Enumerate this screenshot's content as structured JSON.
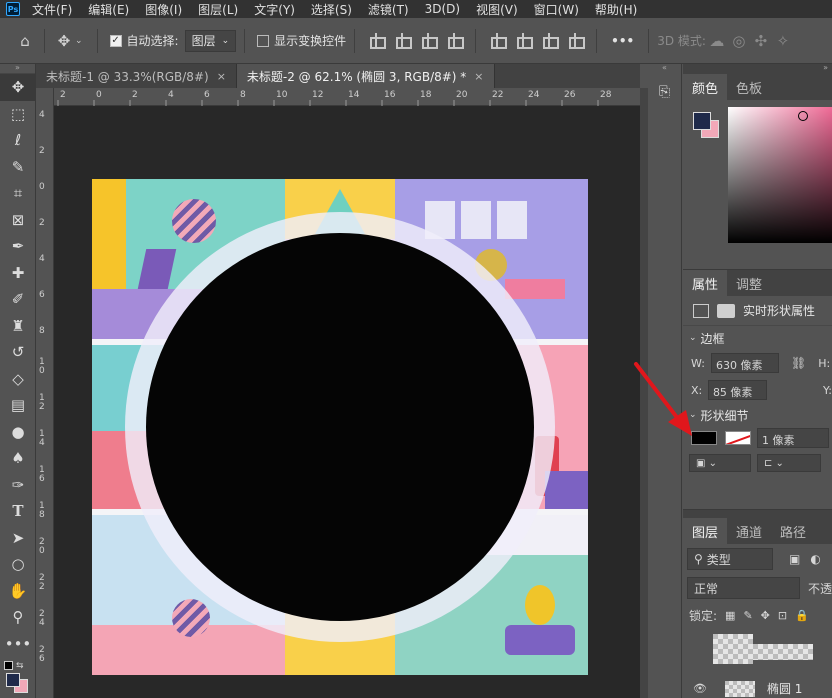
{
  "app": {
    "logo_text": "Ps"
  },
  "menu": [
    "文件(F)",
    "编辑(E)",
    "图像(I)",
    "图层(L)",
    "文字(Y)",
    "选择(S)",
    "滤镜(T)",
    "3D(D)",
    "视图(V)",
    "窗口(W)",
    "帮助(H)"
  ],
  "options": {
    "auto_select_label": "自动选择:",
    "auto_select_value": "图层",
    "show_transform_label": "显示变换控件",
    "more_label": "•••",
    "mode_3d_label": "3D 模式:"
  },
  "tabs": [
    {
      "label": "未标题-1 @ 33.3%(RGB/8#)",
      "close": "×"
    },
    {
      "label": "未标题-2 @ 62.1% (椭圆 3, RGB/8#) *",
      "close": "×"
    }
  ],
  "ruler_top": [
    "2",
    "0",
    "2",
    "4",
    "6",
    "8",
    "10",
    "12",
    "14",
    "16",
    "18",
    "20",
    "22",
    "24",
    "26",
    "28"
  ],
  "ruler_left": [
    "4",
    "2",
    "0",
    "2",
    "4",
    "6",
    "8",
    "1\n0",
    "1\n2",
    "1\n4",
    "1\n6",
    "1\n8",
    "2\n0",
    "2\n2",
    "2\n4",
    "2\n6"
  ],
  "color_panel": {
    "tabs": [
      "颜色",
      "色板"
    ],
    "foreground": "#1f2a4a",
    "background": "#f2a8b8"
  },
  "properties_panel": {
    "tabs": [
      "属性",
      "调整"
    ],
    "shape_label": "实时形状属性",
    "section_transform": "边框",
    "w_label": "W:",
    "w_value": "630 像素",
    "h_label": "H:",
    "x_label": "X:",
    "x_value": "85 像素",
    "y_label": "Y:",
    "section_shape": "形状细节",
    "stroke_width": "1 像素"
  },
  "layers_panel": {
    "tabs": [
      "图层",
      "通道",
      "路径"
    ],
    "filter_label": "类型",
    "blend_mode": "正常",
    "opacity_label": "不透",
    "lock_label": "锁定:",
    "layer_name": "椭圆 1"
  },
  "colors": {
    "accent_arrow": "#e0171c",
    "canvas_circle": "#050505"
  }
}
